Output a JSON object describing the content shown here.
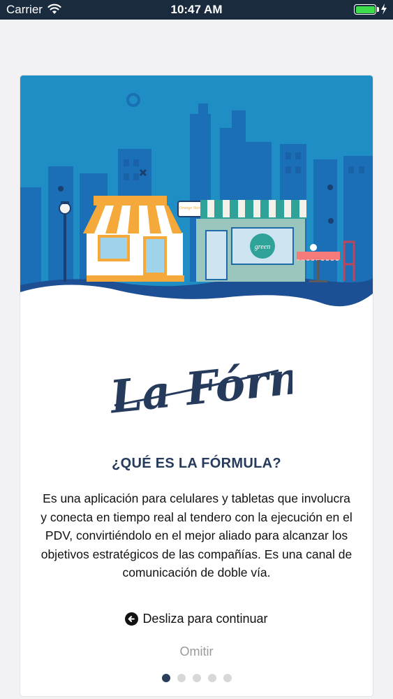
{
  "status_bar": {
    "carrier": "Carrier",
    "time": "10:47 AM",
    "battery_color": "#3ddc4c"
  },
  "hero": {
    "store_left_sign": "Orange Store",
    "store_right_sign": "green"
  },
  "logo": {
    "text": "La Fórmula"
  },
  "onboarding": {
    "title": "¿QUÉ ES LA FÓRMULA?",
    "description": "Es una aplicación para celulares y tabletas que involucra y conecta en tiempo real al tendero con la ejecución en el PDV, convirtiéndolo en el mejor aliado para alcanzar los objetivos estratégicos de las compañías. Es una canal de comunicación de doble vía.",
    "swipe_label": "Desliza para continuar",
    "swipe_icon": "arrow-left-circle-icon",
    "skip_label": "Omitir"
  },
  "pagination": {
    "total": 5,
    "active": 1
  },
  "colors": {
    "title": "#263a5c",
    "sky": "#1f8ec4",
    "buildings": "#1d5fa8",
    "ground": "#1c4f93",
    "awning_left": "#f6a93b",
    "awning_right": "#2fa39a"
  }
}
